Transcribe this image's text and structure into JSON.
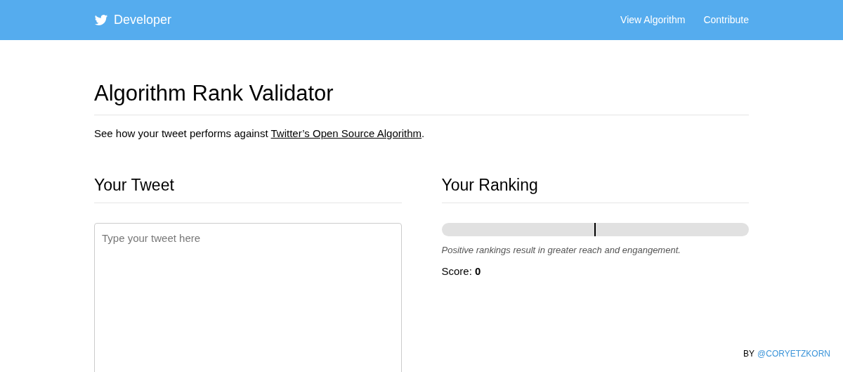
{
  "navbar": {
    "brand": "Developer",
    "links": [
      "View Algorithm",
      "Contribute"
    ]
  },
  "page": {
    "title": "Algorithm Rank Validator",
    "intro": {
      "before": "See how your tweet performs against ",
      "link": "Twitter’s Open Source Algorithm",
      "after": "."
    }
  },
  "tweet": {
    "heading": "Your Tweet",
    "placeholder": "Type your tweet here"
  },
  "ranking": {
    "heading": "Your Ranking",
    "level": 0.5,
    "note": "Positive rankings result in greater reach and engangement.",
    "score": "Score: **0**"
  },
  "footer": {
    "by": "BY",
    "handle": "@CORYETZKORN"
  }
}
